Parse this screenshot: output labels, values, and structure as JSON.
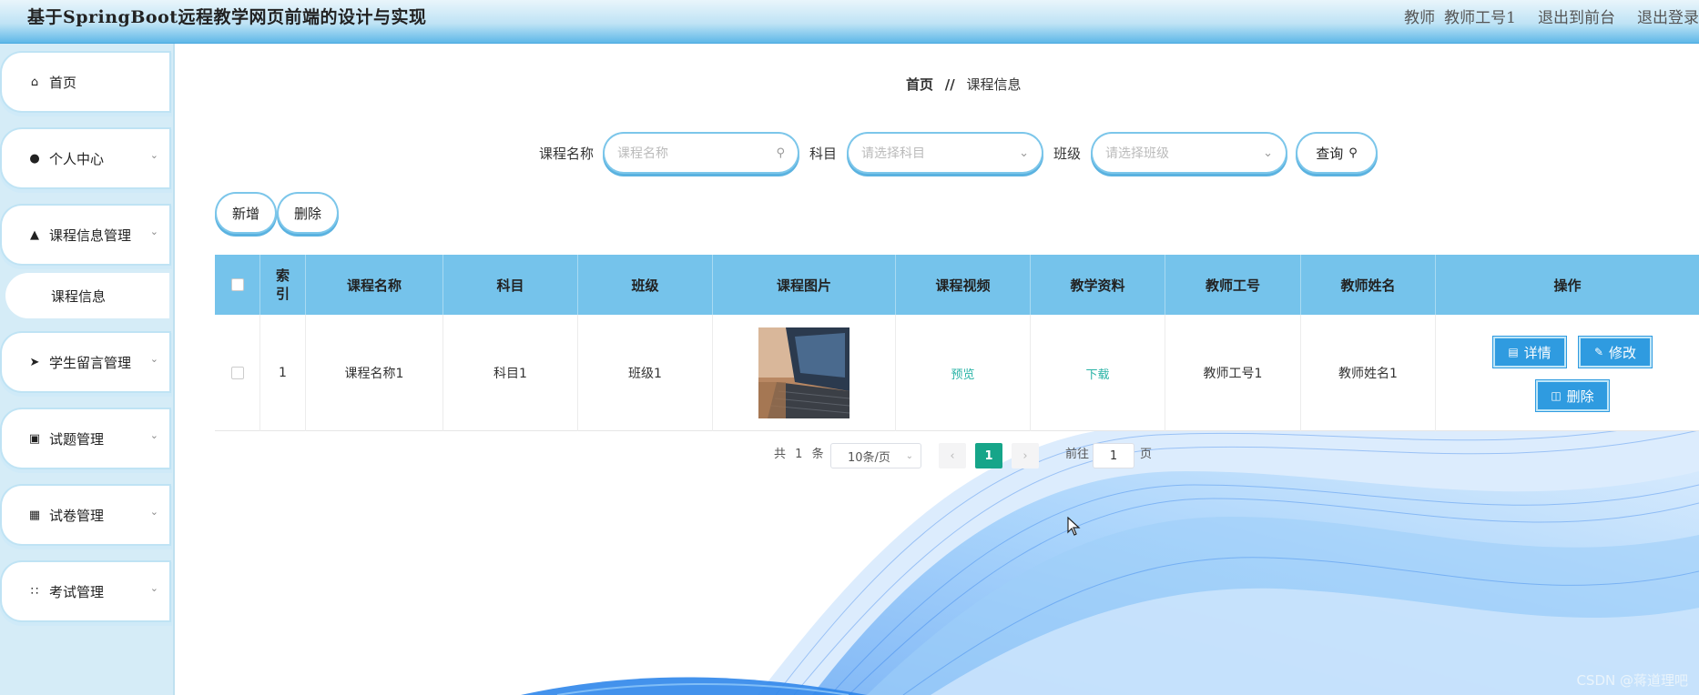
{
  "header": {
    "title": "基于SpringBoot远程教学网页前端的设计与实现",
    "role": "教师",
    "user": "教师工号1",
    "to_front": "退出到前台",
    "logout": "退出登录"
  },
  "sidebar": {
    "items": [
      {
        "label": "首页",
        "icon": "home-icon"
      },
      {
        "label": "个人中心",
        "icon": "user-icon"
      },
      {
        "label": "课程信息管理",
        "icon": "user-manage-icon"
      },
      {
        "label": "学生留言管理",
        "icon": "send-icon"
      },
      {
        "label": "试题管理",
        "icon": "clipboard-icon"
      },
      {
        "label": "试卷管理",
        "icon": "grid-icon"
      },
      {
        "label": "考试管理",
        "icon": "grid-dots-icon"
      }
    ],
    "submenu": {
      "label": "课程信息"
    }
  },
  "breadcrumb": {
    "home": "首页",
    "separator": "//",
    "current": "课程信息"
  },
  "search": {
    "course_name_label": "课程名称",
    "course_name_placeholder": "课程名称",
    "subject_label": "科目",
    "subject_placeholder": "请选择科目",
    "class_label": "班级",
    "class_placeholder": "请选择班级",
    "query_label": "查询"
  },
  "toolbar": {
    "add_label": "新增",
    "delete_label": "删除"
  },
  "table": {
    "headers": {
      "index": "索引",
      "course_name": "课程名称",
      "subject": "科目",
      "class": "班级",
      "course_image": "课程图片",
      "course_video": "课程视频",
      "material": "教学资料",
      "teacher_id": "教师工号",
      "teacher_name": "教师姓名",
      "actions": "操作"
    },
    "rows": [
      {
        "index": "1",
        "course_name": "课程名称1",
        "subject": "科目1",
        "class": "班级1",
        "video_link": "预览",
        "material_link": "下载",
        "teacher_id": "教师工号1",
        "teacher_name": "教师姓名1",
        "detail_label": "详情",
        "edit_label": "修改",
        "delete_label": "删除"
      }
    ]
  },
  "pagination": {
    "total_prefix": "共",
    "total": "1",
    "total_suffix": "条",
    "page_size": "10条/页",
    "current_page": "1",
    "goto_prefix": "前往",
    "goto_value": "1",
    "goto_suffix": "页"
  },
  "watermark": "CSDN @蒋道理吧",
  "colors": {
    "accent": "#2f9be0",
    "header_blue": "#75c3eb",
    "active_page": "#16a589",
    "link": "#2ab3a6"
  }
}
